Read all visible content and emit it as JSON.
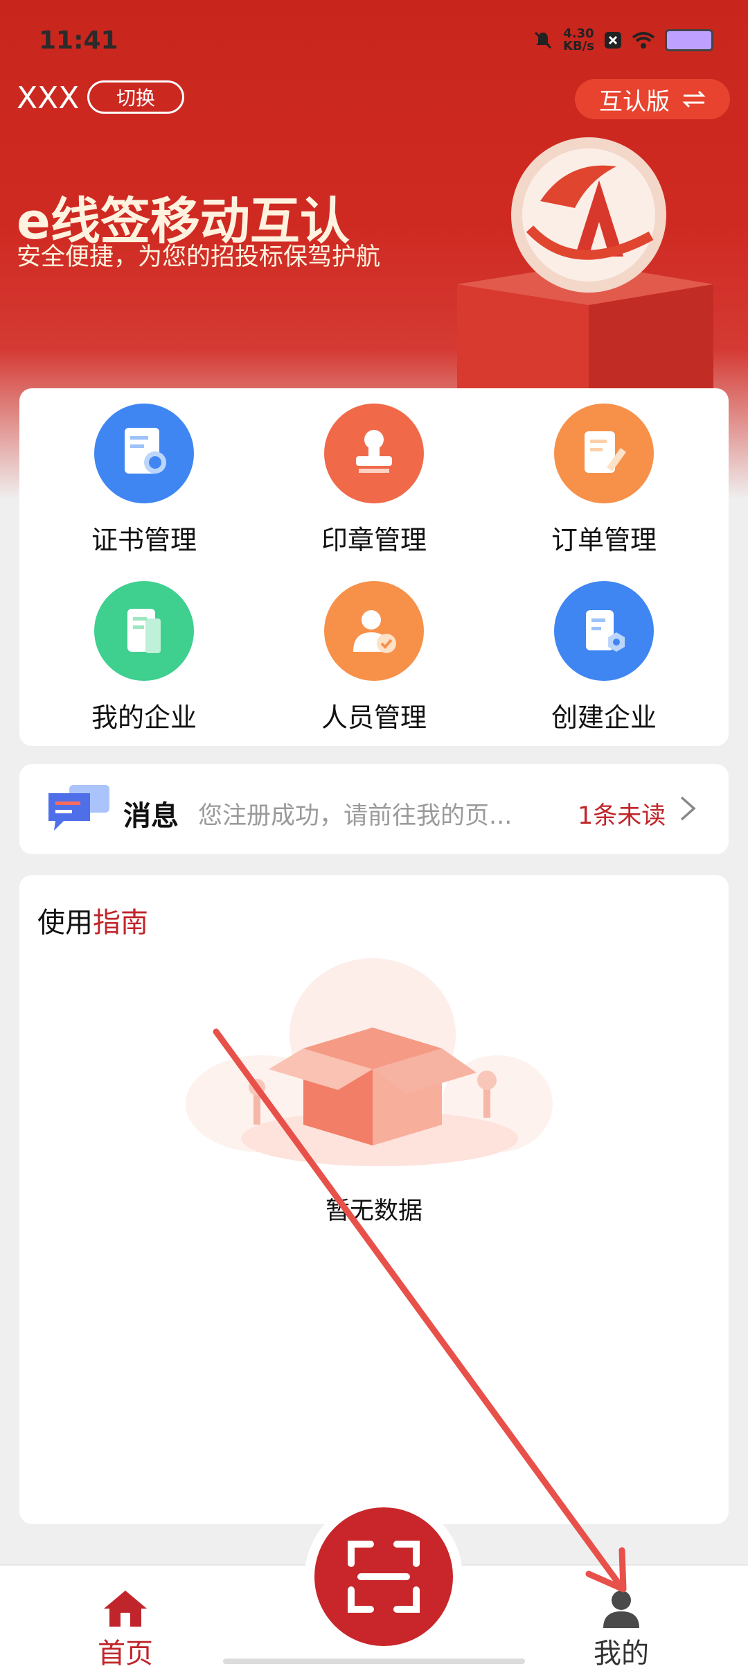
{
  "status_bar": {
    "time": "11:41",
    "speed_value": "4.30",
    "speed_unit": "KB/s"
  },
  "header": {
    "account_name": "XXX",
    "switch_label": "切换",
    "version_label": "互认版"
  },
  "hero": {
    "title": "e线签移动互认",
    "subtitle": "安全便捷，为您的招投标保驾护航"
  },
  "features": [
    {
      "label": "证书管理",
      "icon": "certificate-icon",
      "color": "#3f86f2"
    },
    {
      "label": "印章管理",
      "icon": "stamp-icon",
      "color": "#f06a4a"
    },
    {
      "label": "订单管理",
      "icon": "order-edit-icon",
      "color": "#f7914a"
    },
    {
      "label": "我的企业",
      "icon": "enterprise-doc-icon",
      "color": "#3fcf8f"
    },
    {
      "label": "人员管理",
      "icon": "person-check-icon",
      "color": "#f7914a"
    },
    {
      "label": "创建企业",
      "icon": "create-enterprise-icon",
      "color": "#3f86f2"
    }
  ],
  "message": {
    "title": "消息",
    "preview": "您注册成功，请前往我的页...",
    "unread": "1条未读",
    "icon": "chat-bubbles-icon"
  },
  "guide": {
    "title_prefix": "使用",
    "title_accent": "指南",
    "empty_text": "暂无数据"
  },
  "tabbar": {
    "home_label": "首页",
    "mine_label": "我的"
  },
  "colors": {
    "brand_red": "#c8261d",
    "accent_red": "#c0252b"
  }
}
